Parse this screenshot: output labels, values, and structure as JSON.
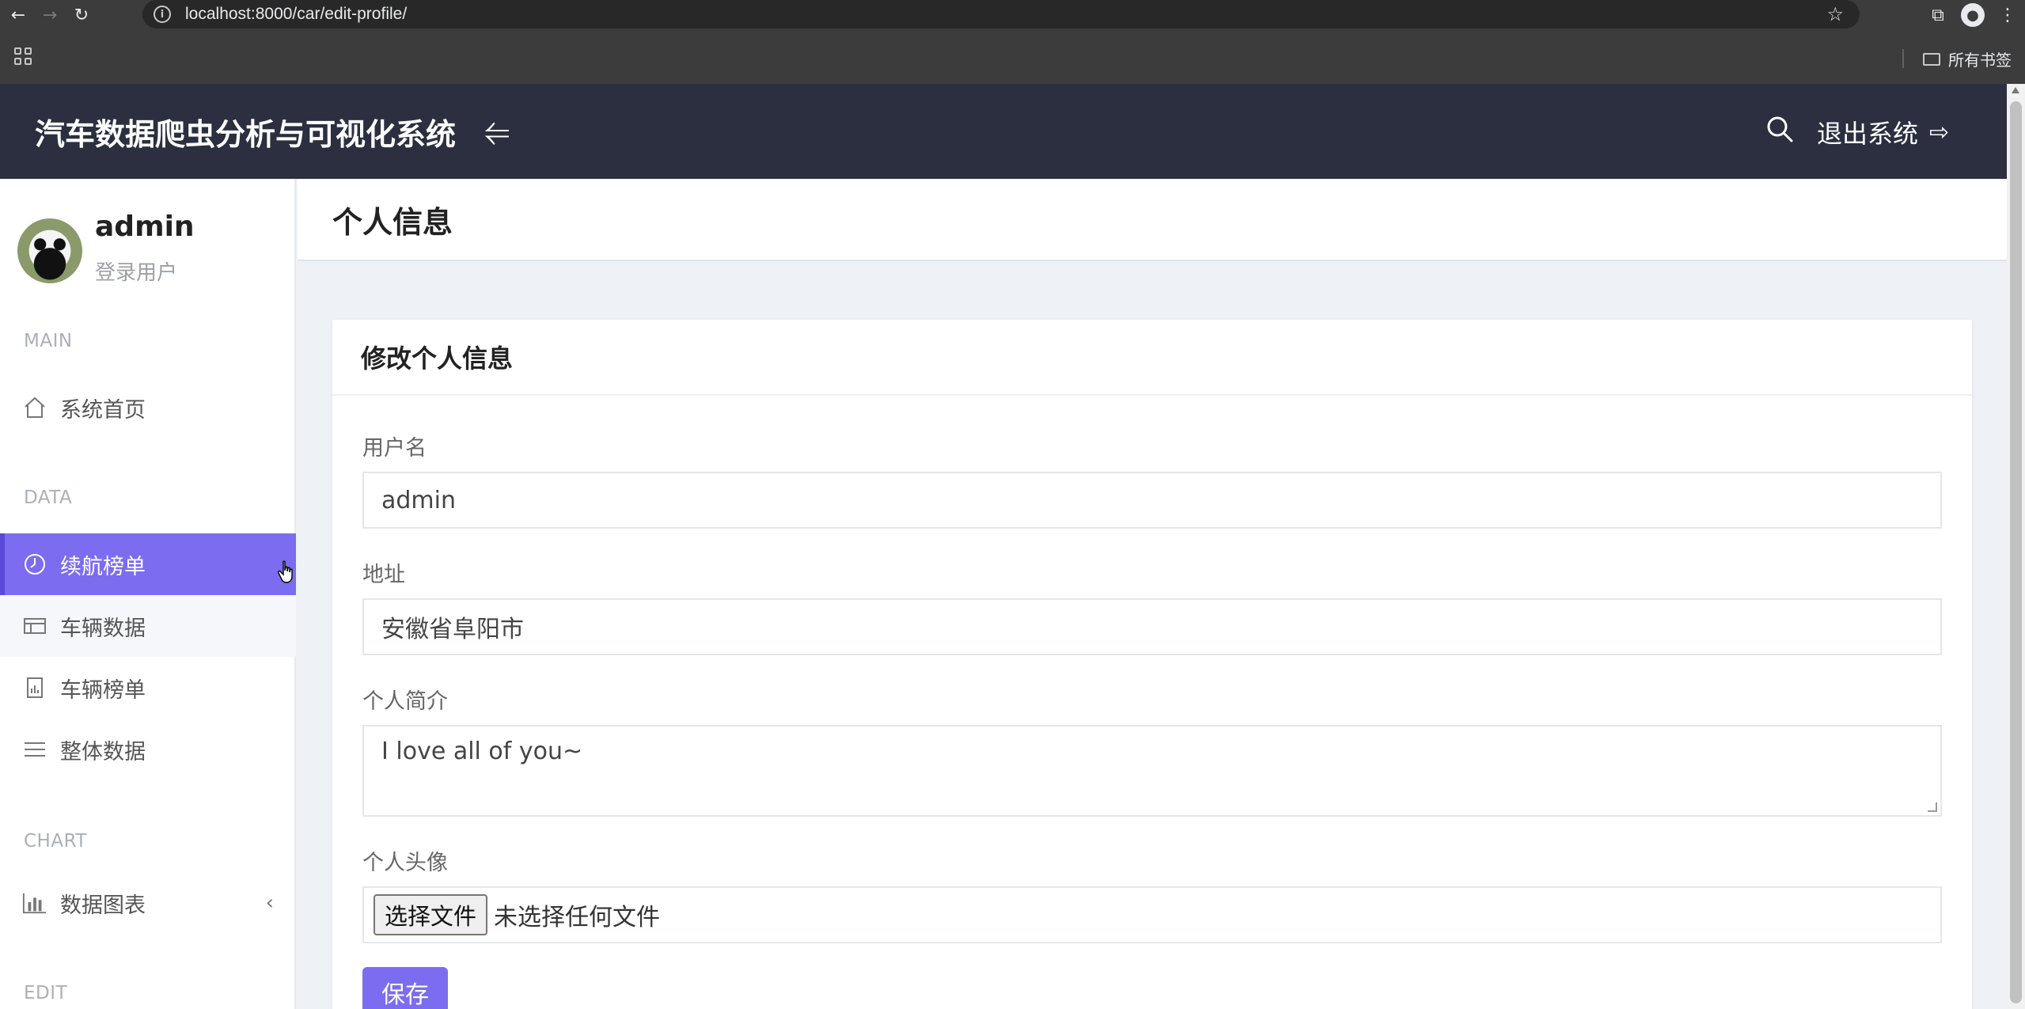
{
  "browser": {
    "url": "localhost:8000/car/edit-profile/",
    "bookmarks_label": "所有书签"
  },
  "header": {
    "app_title": "汽车数据爬虫分析与可视化系统",
    "toggle_icon": "menu-collapse-icon",
    "logout_label": "退出系统"
  },
  "sidebar": {
    "user_name": "admin",
    "user_role": "登录用户",
    "sections": [
      {
        "label": "MAIN"
      },
      {
        "label": "DATA"
      },
      {
        "label": "CHART"
      },
      {
        "label": "EDIT"
      }
    ],
    "items": [
      {
        "label": "系统首页",
        "icon": "home-icon"
      },
      {
        "label": "续航榜单",
        "icon": "clock-icon",
        "active": true
      },
      {
        "label": "车辆数据",
        "icon": "table-icon"
      },
      {
        "label": "车辆榜单",
        "icon": "report-icon"
      },
      {
        "label": "整体数据",
        "icon": "list-icon"
      },
      {
        "label": "数据图表",
        "icon": "bar-chart-icon"
      }
    ]
  },
  "page": {
    "title": "个人信息"
  },
  "form": {
    "card_title": "修改个人信息",
    "username_label": "用户名",
    "username_value": "admin",
    "address_label": "地址",
    "address_value": "安徽省阜阳市",
    "bio_label": "个人简介",
    "bio_value": "I love all of you~",
    "avatar_label": "个人头像",
    "file_button": "选择文件",
    "file_status": "未选择任何文件",
    "save_label": "保存"
  },
  "colors": {
    "accent": "#7b6cf0",
    "header_bg": "#2b2f3f",
    "page_bg": "#eef2f7"
  }
}
